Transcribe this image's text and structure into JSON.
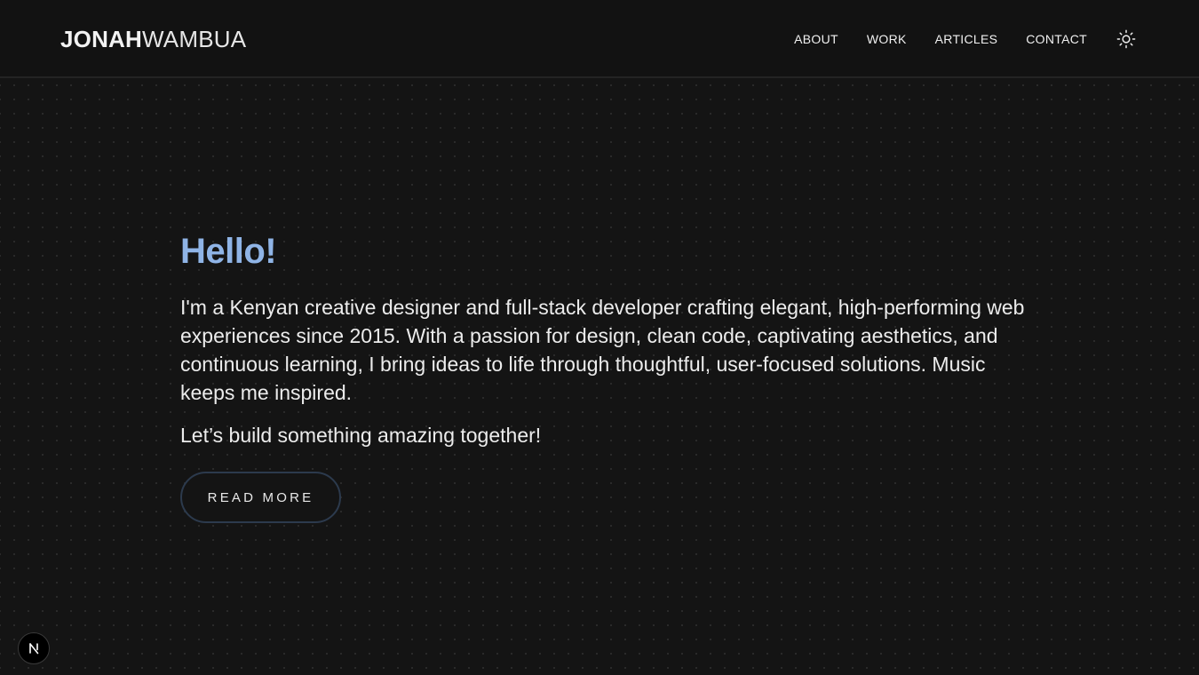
{
  "header": {
    "logo_first": "JONAH",
    "logo_last": "WAMBUA",
    "nav": [
      "ABOUT",
      "WORK",
      "ARTICLES",
      "CONTACT"
    ],
    "theme_toggle_icon": "sun-icon"
  },
  "hero": {
    "greeting": "Hello!",
    "bio": "I'm a Kenyan creative designer and full-stack developer crafting elegant, high-performing web experiences since 2015. With a passion for design, clean code, captivating aesthetics, and continuous learning, I bring ideas to life through thoughtful, user-focused solutions. Music keeps me inspired.",
    "cta_text": "Let’s build something amazing together!",
    "button_label": "READ MORE"
  },
  "colors": {
    "background": "#141414",
    "header_background": "#121212",
    "accent": "#8fb4e6",
    "button_border": "#2c3a4d"
  },
  "dev_badge_icon": "nextjs-n-icon"
}
